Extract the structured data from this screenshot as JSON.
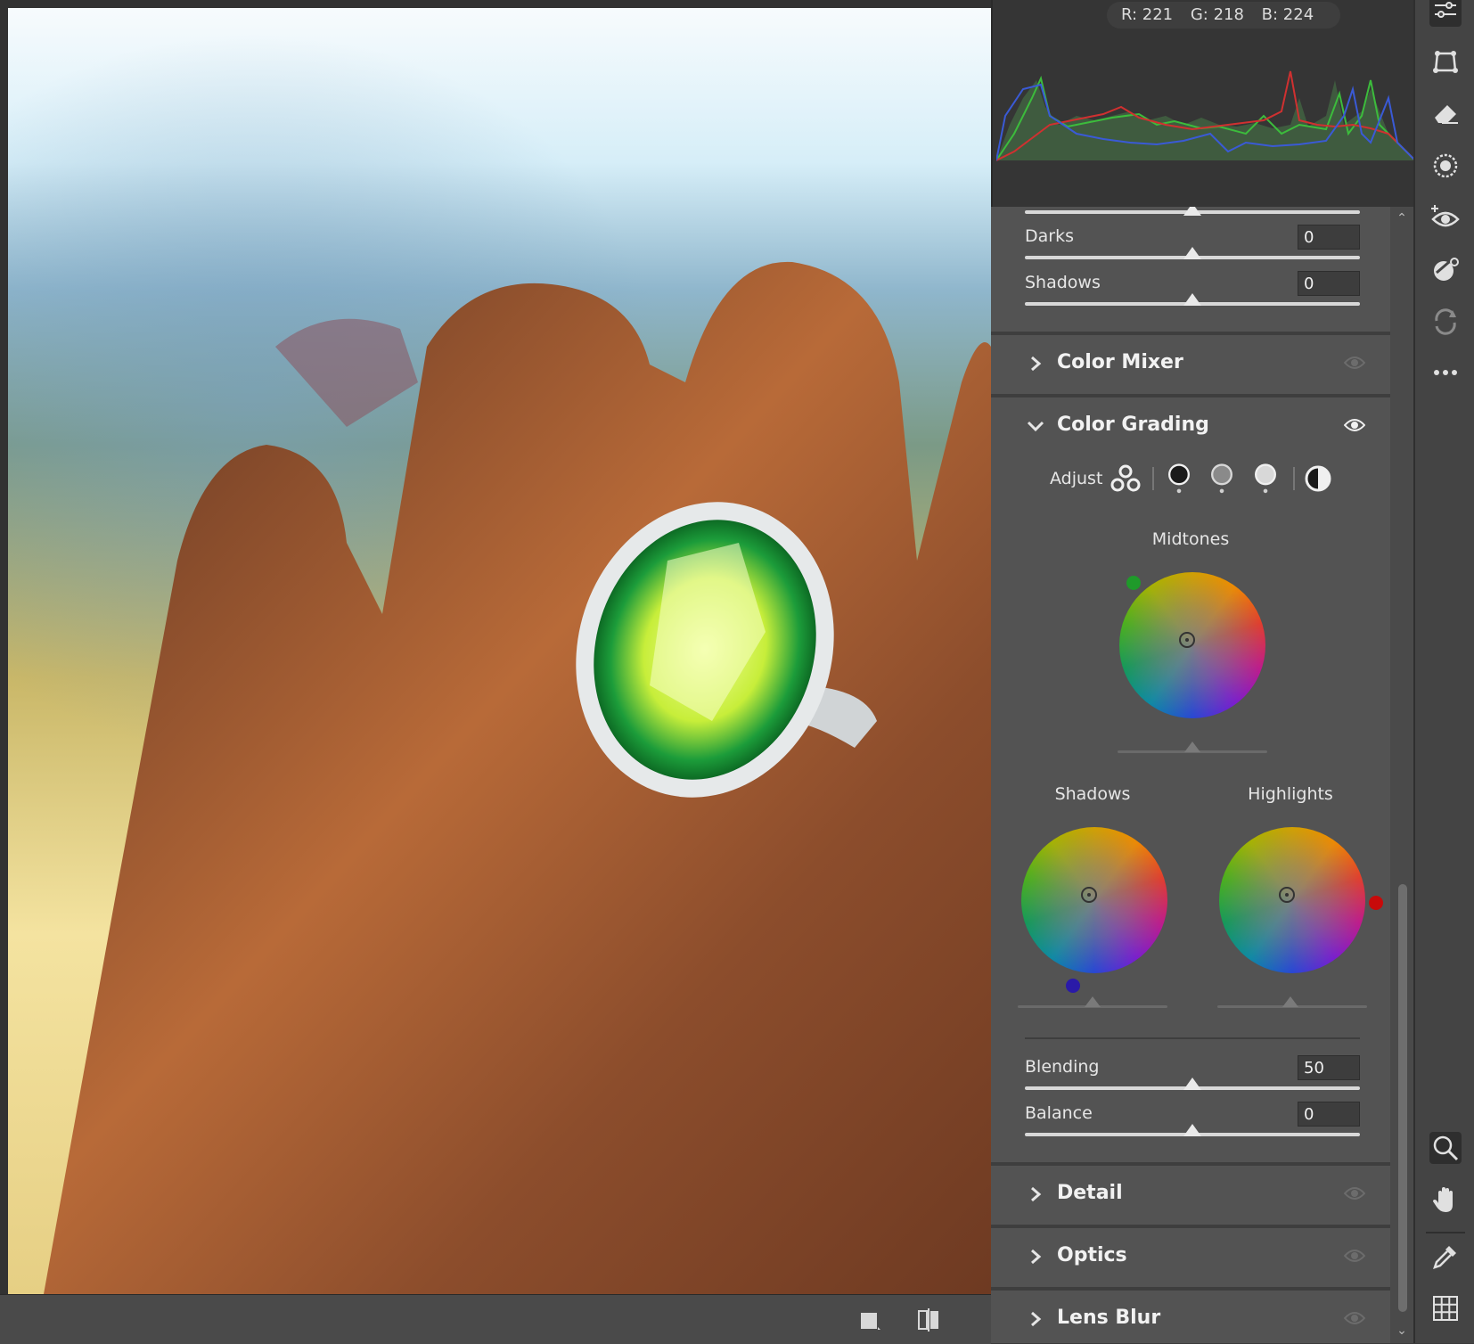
{
  "histogram": {
    "readout": {
      "r": "R: 221",
      "g": "G: 218",
      "b": "B: 224"
    }
  },
  "tone": {
    "darks": {
      "label": "Darks",
      "value": "0"
    },
    "shadows": {
      "label": "Shadows",
      "value": "0"
    }
  },
  "sections": {
    "color_mixer": "Color Mixer",
    "color_grading": "Color Grading",
    "detail": "Detail",
    "optics": "Optics",
    "lens_blur": "Lens Blur"
  },
  "color_grading": {
    "adjust_label": "Adjust",
    "midtones_label": "Midtones",
    "shadows_label": "Shadows",
    "highlights_label": "Highlights",
    "blending": {
      "label": "Blending",
      "value": "50"
    },
    "balance": {
      "label": "Balance",
      "value": "0"
    },
    "dot_colors": {
      "midtones": "#1f9a2a",
      "shadows": "#2a1aa8",
      "highlights": "#c80a0a"
    }
  },
  "icons": {
    "toolbar": [
      "edit-sliders-icon",
      "crop-icon",
      "eraser-icon",
      "masking-icon",
      "red-eye-icon",
      "presets-icon",
      "snapshots-icon",
      "more-icon",
      "zoom-icon",
      "hand-icon",
      "color-sampler-icon",
      "grid-icon"
    ],
    "bottom_bar": [
      "single-view-icon",
      "before-after-icon"
    ]
  }
}
